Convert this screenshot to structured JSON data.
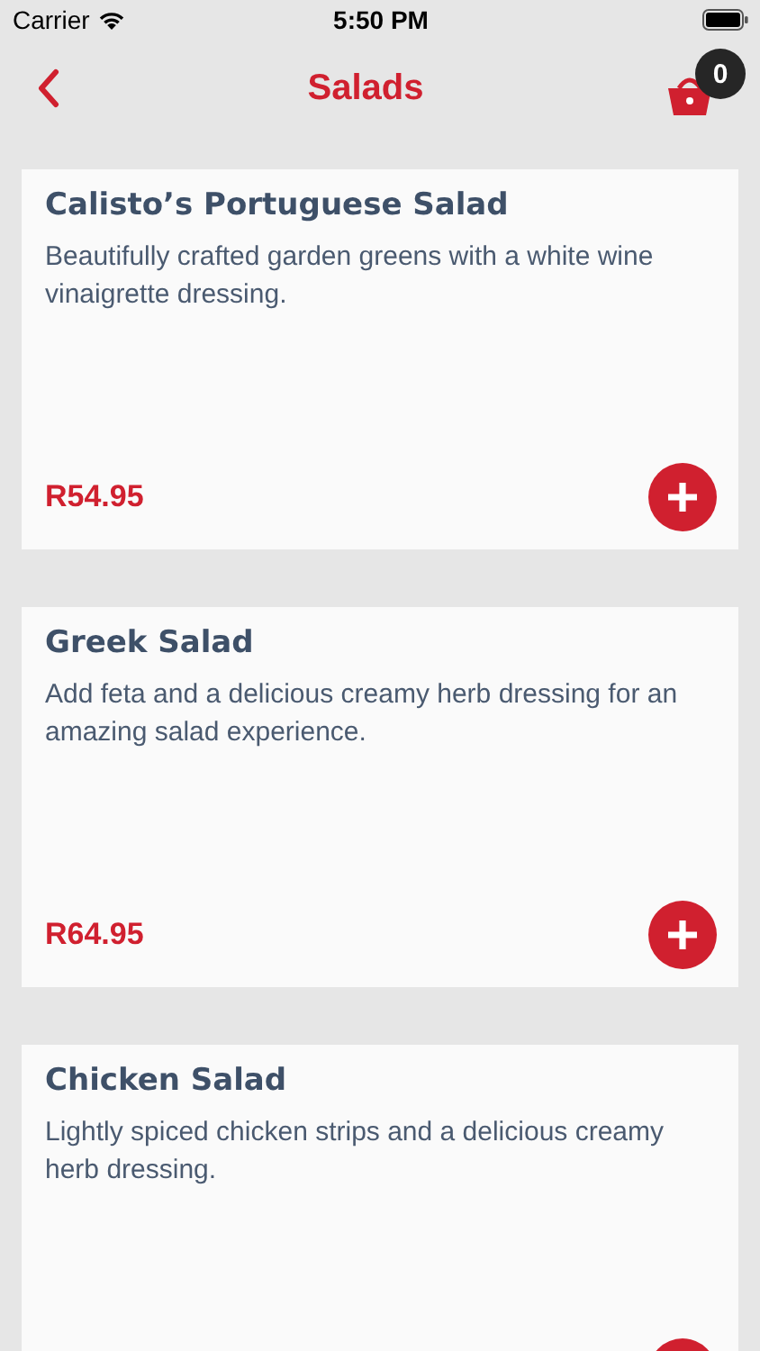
{
  "status_bar": {
    "carrier": "Carrier",
    "time": "5:50 PM"
  },
  "nav": {
    "title": "Salads",
    "cart_count": "0"
  },
  "items": [
    {
      "name": "Calisto’s Portuguese Salad",
      "description": "Beautifully crafted garden greens with a white wine vinaigrette dressing.",
      "price": "R54.95"
    },
    {
      "name": "Greek Salad",
      "description": "Add feta and a delicious creamy herb dressing for an amazing salad experience.",
      "price": "R64.95"
    },
    {
      "name": "Chicken Salad",
      "description": "Lightly spiced chicken strips and a delicious creamy herb dressing."
    }
  ]
}
